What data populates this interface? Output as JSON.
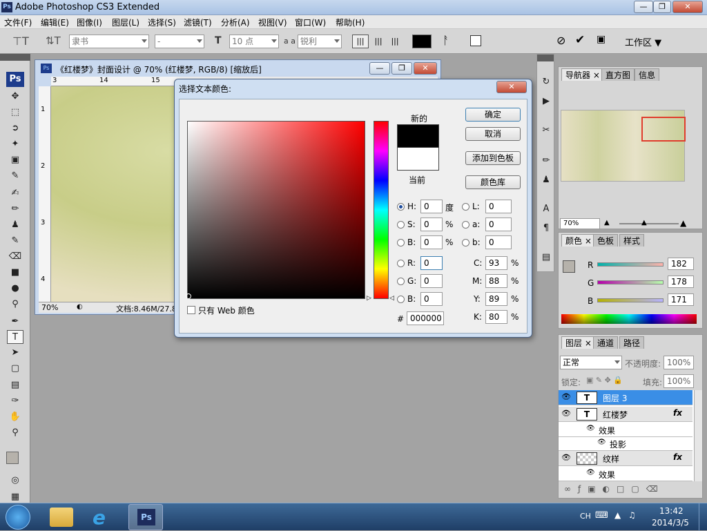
{
  "app": {
    "title": "Adobe Photoshop CS3 Extended",
    "icon": "Ps"
  },
  "menu": [
    "文件(F)",
    "编辑(E)",
    "图像(I)",
    "图层(L)",
    "选择(S)",
    "滤镜(T)",
    "分析(A)",
    "视图(V)",
    "窗口(W)",
    "帮助(H)"
  ],
  "options": {
    "font_family": "隶书",
    "font_style": "-",
    "font_size": "10 点",
    "antialias_label": "a a",
    "antialias": "锐利",
    "workspace": "工作区"
  },
  "document": {
    "title": "《红楼梦》封面设计 @ 70% (红楼梦, RGB/8) [缩放后]",
    "zoom": "70%",
    "status": "文档:8.46M/27.8",
    "ruler_h": [
      "3",
      "14",
      "15"
    ],
    "ruler_v": [
      "1",
      "2",
      "3",
      "4"
    ]
  },
  "dialog": {
    "title": "选择文本颜色:",
    "new_label": "新的",
    "current_label": "当前",
    "ok": "确定",
    "cancel": "取消",
    "add_swatch": "添加到色板",
    "color_library": "颜色库",
    "web_only": "只有 Web 颜色",
    "H": {
      "label": "H:",
      "value": "0",
      "unit": "度"
    },
    "S": {
      "label": "S:",
      "value": "0",
      "unit": "%"
    },
    "Bv": {
      "label": "B:",
      "value": "0",
      "unit": "%"
    },
    "R": {
      "label": "R:",
      "value": "0"
    },
    "G": {
      "label": "G:",
      "value": "0"
    },
    "Bb": {
      "label": "B:",
      "value": "0"
    },
    "L": {
      "label": "L:",
      "value": "0"
    },
    "a": {
      "label": "a:",
      "value": "0"
    },
    "b": {
      "label": "b:",
      "value": "0"
    },
    "C": {
      "label": "C:",
      "value": "93",
      "unit": "%"
    },
    "M": {
      "label": "M:",
      "value": "88",
      "unit": "%"
    },
    "Y": {
      "label": "Y:",
      "value": "89",
      "unit": "%"
    },
    "K": {
      "label": "K:",
      "value": "80",
      "unit": "%"
    },
    "hex_label": "#",
    "hex": "000000",
    "new_color": "#000000",
    "current_color": "#ffffff"
  },
  "navigator": {
    "tabs": [
      "导航器",
      "直方图",
      "信息"
    ],
    "zoom": "70%"
  },
  "color_panel": {
    "tabs": [
      "颜色",
      "色板",
      "样式"
    ],
    "R": {
      "label": "R",
      "value": "182"
    },
    "G": {
      "label": "G",
      "value": "178"
    },
    "B": {
      "label": "B",
      "value": "171"
    }
  },
  "layers_panel": {
    "tabs": [
      "图层",
      "通道",
      "路径"
    ],
    "blend": "正常",
    "opacity_label": "不透明度:",
    "opacity": "100%",
    "lock_label": "锁定:",
    "fill_label": "填充:",
    "fill": "100%",
    "layers": [
      {
        "name": "图层 3",
        "type": "T",
        "selected": true
      },
      {
        "name": "红楼梦",
        "type": "T",
        "fx": "fx"
      },
      {
        "name": "效果",
        "sub": true
      },
      {
        "name": "投影",
        "sub2": true
      },
      {
        "name": "纹样",
        "type": "img",
        "fx": "fx"
      },
      {
        "name": "效果",
        "sub": true
      }
    ]
  },
  "taskbar": {
    "lang": "CH",
    "time": "13:42",
    "date": "2014/3/5"
  }
}
